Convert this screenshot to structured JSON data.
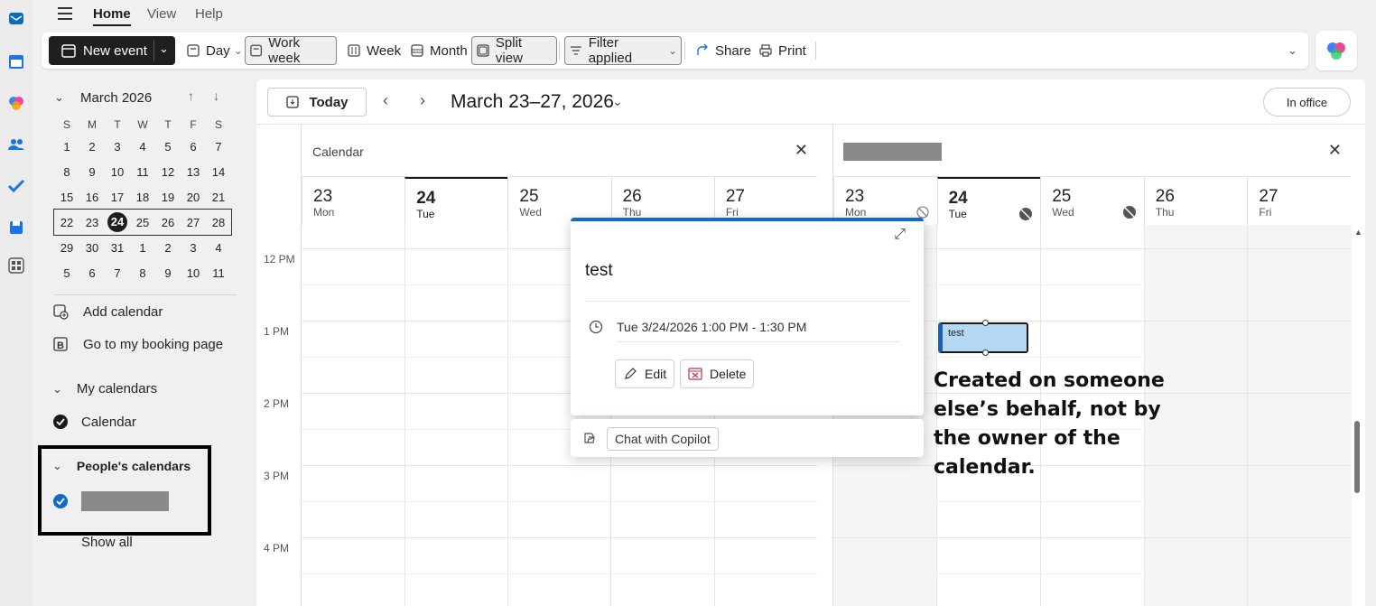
{
  "menu": {
    "tabs": [
      "Home",
      "View",
      "Help"
    ]
  },
  "toolbar": {
    "new_event": "New event",
    "day": "Day",
    "work_week": "Work week",
    "week": "Week",
    "month": "Month",
    "split_view": "Split view",
    "filter": "Filter applied",
    "share": "Share",
    "print": "Print"
  },
  "mini_calendar": {
    "title": "March 2026",
    "weekdays": [
      "S",
      "M",
      "T",
      "W",
      "T",
      "F",
      "S"
    ],
    "weeks": [
      [
        "1",
        "2",
        "3",
        "4",
        "5",
        "6",
        "7"
      ],
      [
        "8",
        "9",
        "10",
        "11",
        "12",
        "13",
        "14"
      ],
      [
        "15",
        "16",
        "17",
        "18",
        "19",
        "20",
        "21"
      ],
      [
        "22",
        "23",
        "24",
        "25",
        "26",
        "27",
        "28"
      ],
      [
        "29",
        "30",
        "31",
        "1",
        "2",
        "3",
        "4"
      ],
      [
        "5",
        "6",
        "7",
        "8",
        "9",
        "10",
        "11"
      ]
    ],
    "today": "24"
  },
  "left_pane": {
    "add_calendar": "Add calendar",
    "booking": "Go to my booking page",
    "my_calendars": "My calendars",
    "calendar": "Calendar",
    "peoples_calendars": "People's calendars",
    "show_all": "Show all"
  },
  "main": {
    "today_label": "Today",
    "range": "March 23–27, 2026",
    "in_office": "In office",
    "left_pane_title": "Calendar",
    "days": [
      {
        "num": "23",
        "name": "Mon"
      },
      {
        "num": "24",
        "name": "Tue"
      },
      {
        "num": "25",
        "name": "Wed"
      },
      {
        "num": "26",
        "name": "Thu"
      },
      {
        "num": "27",
        "name": "Fri"
      }
    ],
    "times": [
      "12 PM",
      "1 PM",
      "2 PM",
      "3 PM",
      "4 PM"
    ]
  },
  "event": {
    "title": "test"
  },
  "popup": {
    "title": "test",
    "time": "Tue 3/24/2026 1:00 PM - 1:30 PM",
    "edit": "Edit",
    "delete": "Delete",
    "chat": "Chat with Copilot"
  },
  "annotation": "Created on someone else’s behalf, not by the owner of the calendar.",
  "colors": {
    "accent": "#1468c8",
    "event_fill": "#b4d8f4",
    "delete_red": "#c4314b"
  }
}
